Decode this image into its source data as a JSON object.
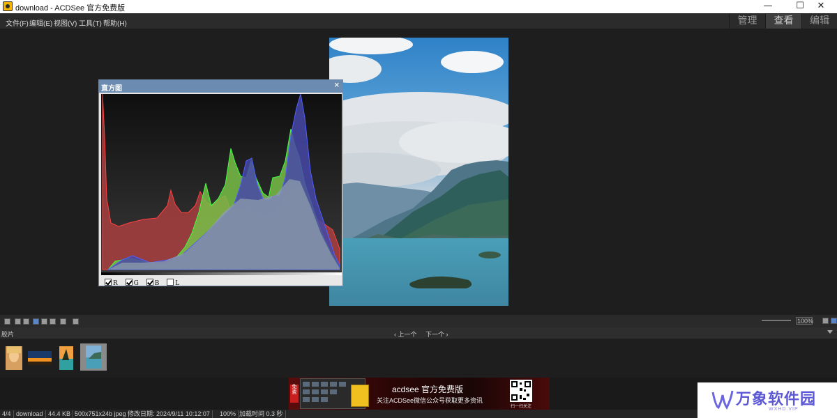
{
  "window": {
    "title": "download - ACDSee 官方免费版",
    "min_glyph": "—",
    "max_glyph": "☐",
    "close_glyph": "✕"
  },
  "menu": [
    "文件(F)",
    "编辑(E)",
    "视图(V)",
    "工具(T)",
    "帮助(H)"
  ],
  "modes": {
    "manage": "管理",
    "view": "查看",
    "edit": "编辑",
    "active": "view"
  },
  "histogram": {
    "title": "直方图",
    "close": "×",
    "channels": [
      {
        "label": "R",
        "checked": true,
        "color": "#d23c3c"
      },
      {
        "label": "G",
        "checked": true,
        "color": "#3ccf3c"
      },
      {
        "label": "B",
        "checked": true,
        "color": "#4545e0"
      },
      {
        "label": "L",
        "checked": false,
        "color": "#c8c8c8"
      }
    ]
  },
  "toolbar": {
    "zoom": "100%"
  },
  "filmstrip": {
    "label": "胶片",
    "prev": "‹ 上一个",
    "next": "下一个 ›",
    "thumbnails": 4,
    "selected_index": 3
  },
  "ad": {
    "badge": "免费",
    "brand": "acdsee 官方免费版",
    "text": "关注ACDSee微信公众号获取更多资讯",
    "qr_caption": "扫一扫关注"
  },
  "watermark": {
    "text": "万象软件园",
    "sub": "WXHD.VIP"
  },
  "status": {
    "index": "4/4",
    "filename": "download",
    "filesize": "44.4 KB",
    "dims": "500x751x24b jpeg",
    "modified": "修改日期: 2024/9/11 10:12:07",
    "zoom": "100%",
    "load_time": "加载时间 0.3 秒"
  }
}
